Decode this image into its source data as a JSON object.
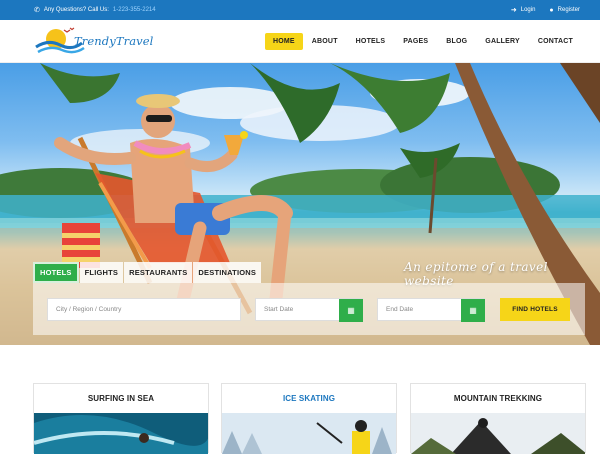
{
  "topbar": {
    "question": "Any Questions? Call Us:",
    "phone": "1-223-355-2214",
    "login": "Login",
    "register": "Register"
  },
  "logo": {
    "part1": "Trendy",
    "part2": "Travel"
  },
  "nav": {
    "items": [
      "HOME",
      "ABOUT",
      "HOTELS",
      "PAGES",
      "BLOG",
      "GALLERY",
      "CONTACT"
    ],
    "active": "HOME"
  },
  "hero": {
    "tagline": "An epitome of a travel website"
  },
  "search": {
    "tabs": [
      "HOTELS",
      "FLIGHTS",
      "RESTAURANTS",
      "DESTINATIONS"
    ],
    "active_tab": "HOTELS",
    "city_placeholder": "City / Region / Country",
    "start_placeholder": "Start Date",
    "end_placeholder": "End Date",
    "find_label": "FIND HOTELS"
  },
  "cards": [
    {
      "title": "SURFING IN SEA"
    },
    {
      "title": "ICE SKATING"
    },
    {
      "title": "MOUNTAIN TREKKING"
    }
  ],
  "colors": {
    "brand_blue": "#1c77bf",
    "accent_yellow": "#f6d518",
    "accent_green": "#2fae4a"
  }
}
